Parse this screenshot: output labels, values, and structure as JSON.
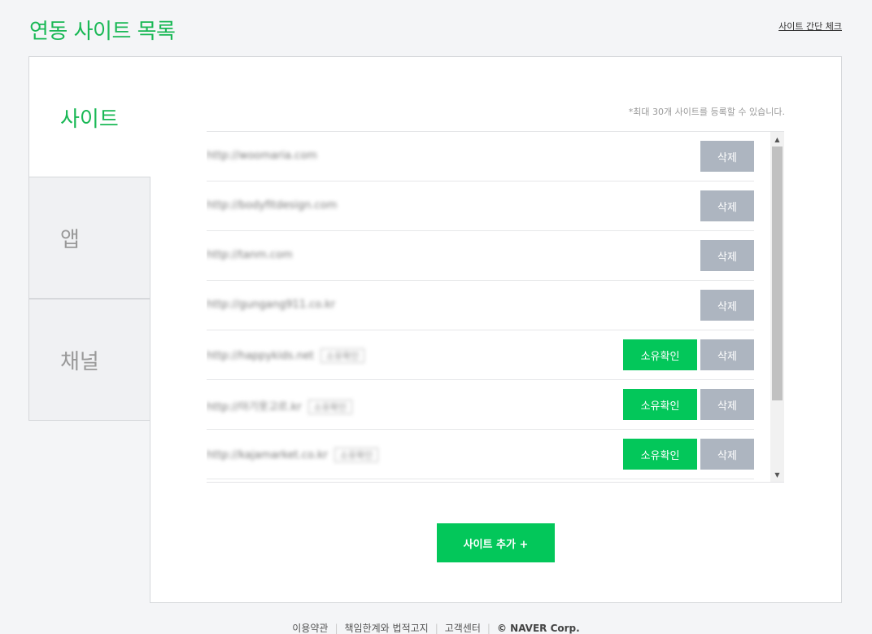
{
  "header": {
    "title": "연동 사이트 목록",
    "simple_check": "사이트 간단 체크"
  },
  "tabs": {
    "site": "사이트",
    "app": "앱",
    "channel": "채널"
  },
  "note": "*최대 30개 사이트를 등록할 수 있습니다.",
  "sites": [
    {
      "url": "http://woomaria.com",
      "tag": "",
      "owner_check": ""
    },
    {
      "url": "http://bodyfitdesign.com",
      "tag": "",
      "owner_check": ""
    },
    {
      "url": "http://tanm.com",
      "tag": "",
      "owner_check": ""
    },
    {
      "url": "http://gungang911.co.kr",
      "tag": "",
      "owner_check": ""
    },
    {
      "url": "http://happykids.net",
      "tag": "소유확인",
      "owner_check": "소유확인"
    },
    {
      "url": "http://아기옷고르.kr",
      "tag": "소유확인",
      "owner_check": "소유확인"
    },
    {
      "url": "http://kajamarket.co.kr",
      "tag": "소유확인",
      "owner_check": "소유확인"
    }
  ],
  "buttons": {
    "delete": "삭제",
    "add_site": "사이트 추가 +"
  },
  "footer": {
    "terms": "이용약관",
    "disclaimer": "책임한계와 법적고지",
    "support": "고객센터",
    "copyright": "© NAVER Corp."
  }
}
